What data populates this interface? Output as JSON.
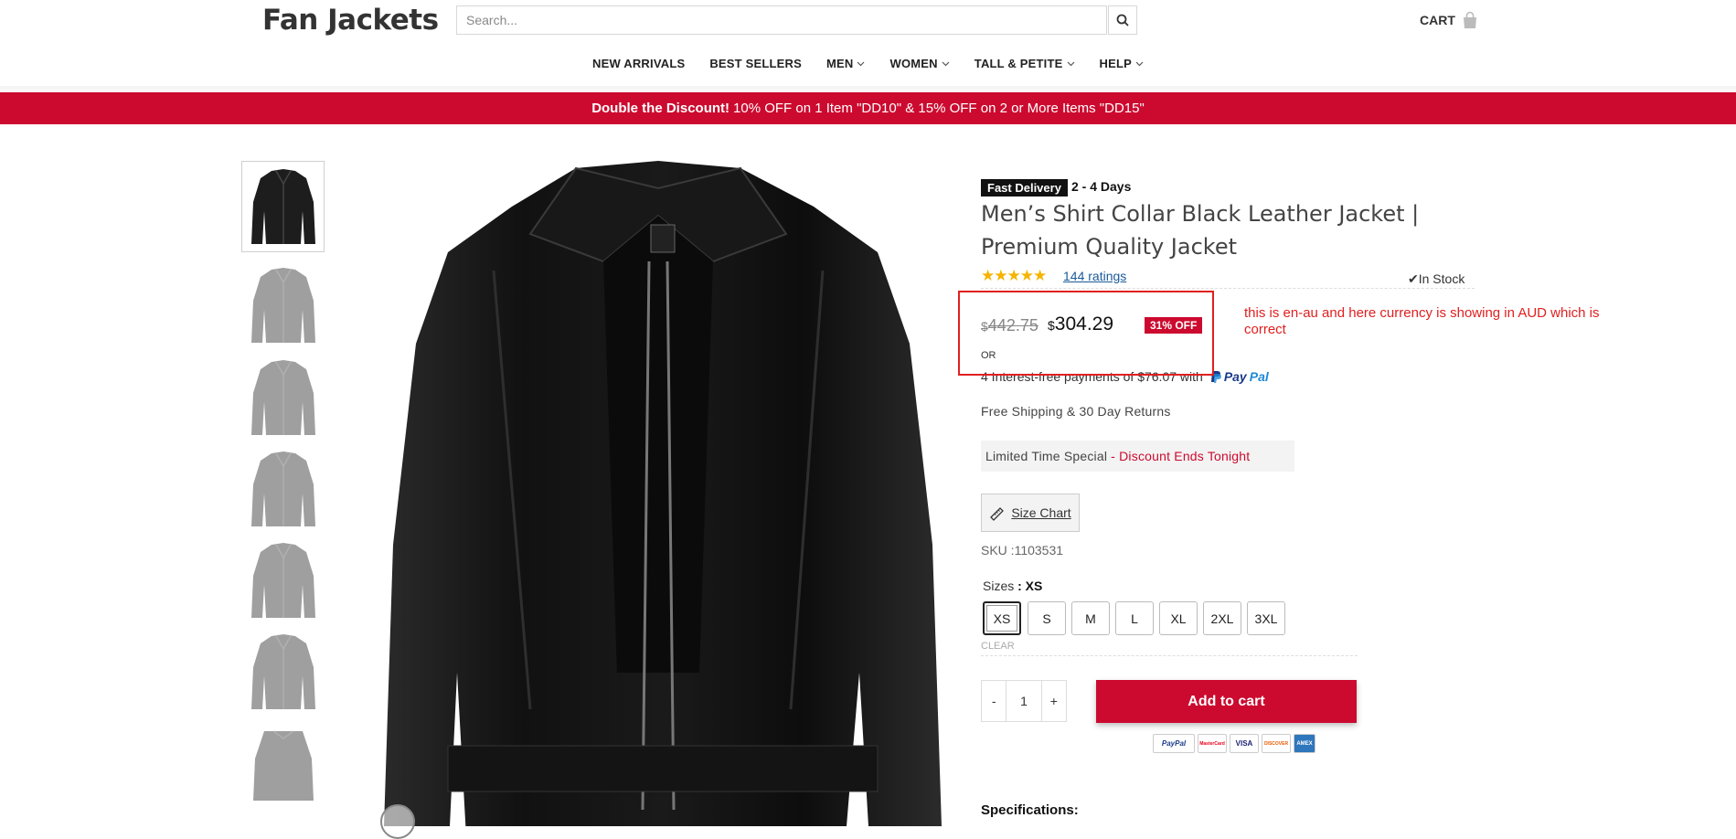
{
  "header": {
    "logo": "Fan Jackets",
    "search_placeholder": "Search...",
    "cart_label": "CART"
  },
  "nav": {
    "items": [
      {
        "label": "NEW ARRIVALS",
        "dropdown": false
      },
      {
        "label": "BEST SELLERS",
        "dropdown": false
      },
      {
        "label": "MEN",
        "dropdown": true
      },
      {
        "label": "WOMEN",
        "dropdown": true
      },
      {
        "label": "TALL & PETITE",
        "dropdown": true
      },
      {
        "label": "HELP",
        "dropdown": true
      }
    ]
  },
  "banner": {
    "bold": "Double the Discount!",
    "text": "10% OFF on 1 Item \"DD10\" & 15% OFF on 2 or More Items \"DD15\""
  },
  "product": {
    "badge": "Fast Delivery",
    "delivery_days": "2 - 4 Days",
    "title": "Men’s Shirt Collar Black Leather Jacket | Premium Quality Jacket",
    "rating_stars": 5,
    "ratings_link": "144 ratings",
    "stock": "In Stock",
    "currency_symbol": "$",
    "old_price": "442.75",
    "new_price": "304.29",
    "discount_badge": "31% OFF",
    "or_label": "OR",
    "paypal_text": "4 Interest-free payments of $76.07 with",
    "paypal_brand_1": "Pay",
    "paypal_brand_2": "Pal",
    "shipping": "Free Shipping & 30 Day Returns",
    "limited_text": "Limited Time Special",
    "limited_red": "- Discount Ends Tonight",
    "size_chart": "Size Chart",
    "sku": "SKU :1103531",
    "sizes_label": "Sizes",
    "selected_size": ": XS",
    "sizes": [
      "XS",
      "S",
      "M",
      "L",
      "XL",
      "2XL",
      "3XL"
    ],
    "clear_label": "CLEAR",
    "qty_minus": "-",
    "qty_value": "1",
    "qty_plus": "+",
    "add_to_cart": "Add to cart",
    "payment_icons": [
      "PayPal",
      "MasterCard",
      "VISA",
      "DISCOVER",
      "AMEX"
    ],
    "specs_heading": "Specifications:"
  },
  "annotation": {
    "text": "this is en-au and here currency is showing in AUD which is correct",
    "color": "#e02020"
  },
  "colors": {
    "brand_red": "#cc0a2f",
    "star": "#f5b400",
    "link": "#1a5a9a"
  }
}
